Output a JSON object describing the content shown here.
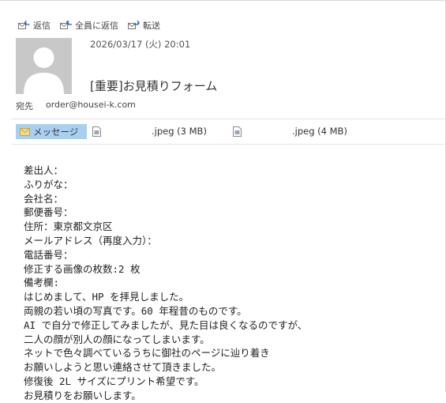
{
  "toolbar": {
    "reply": "返信",
    "reply_all": "全員に返信",
    "forward": "転送"
  },
  "header": {
    "timestamp": "2026/03/17 (火) 20:01",
    "subject": "[重要]お見積りフォーム",
    "to_label": "宛先",
    "to_address": "order@housei-k.com"
  },
  "attachments": {
    "message_tab": "メッセージ",
    "files": [
      {
        "name": ".jpeg (3 MB)",
        "icon": "image-file-icon"
      },
      {
        "name": ".jpeg (4 MB)",
        "icon": "image-file-icon"
      }
    ]
  },
  "body_lines": [
    "差出人：",
    "ふりがな：",
    "会社名：",
    "郵便番号：",
    "住所：東京都文京区",
    "メールアドレス（再度入力）：",
    "電話番号：",
    "修正する画像の枚数:2 枚",
    "備考欄:",
    "はじめまして、HP を拝見しました。",
    "両親の若い頃の写真です。60 年程昔のものです。",
    "AI で自分で修正してみましたが、見た目は良くなるのですが、",
    "二人の顔が別人の顔になってしまいます。",
    "ネットで色々調べているうちに御社のページに辿り着き",
    "お願いしようと思い連絡させて頂きました。",
    "修復後 2L サイズにプリント希望です。",
    "お見積りをお願いします。"
  ],
  "colors": {
    "message_tab_bg": "#a9d0f1",
    "avatar_bg": "#c8c8c8"
  }
}
